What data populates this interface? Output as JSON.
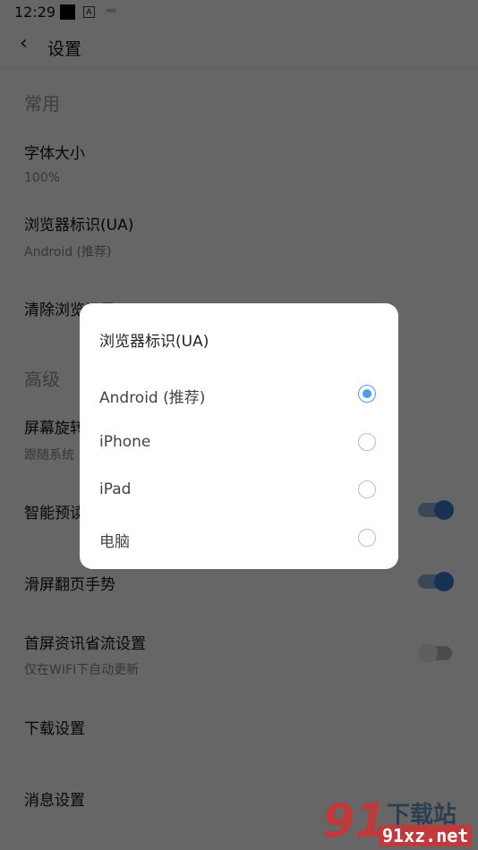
{
  "status_bar": {
    "time": "12:29",
    "icons": [
      "square-notification-icon",
      "a-notification-icon",
      "hms-icon",
      "wifi-icon",
      "battery-charging-icon"
    ],
    "hms_label": "HMS",
    "a_label": "A"
  },
  "header": {
    "back_icon": "‹",
    "title": "设置"
  },
  "sections": [
    {
      "label": "常用"
    },
    {
      "label": "高级"
    }
  ],
  "settings": {
    "font_size": {
      "title": "字体大小",
      "value": "100%"
    },
    "user_agent": {
      "title": "浏览器标识(UA)",
      "value": "Android (推荐)"
    },
    "clear_history": {
      "title": "清除浏览记录"
    },
    "screen_rotation": {
      "title": "屏幕旋转",
      "value": "跟随系统"
    },
    "smart_preload": {
      "title": "智能预读",
      "enabled": true
    },
    "swipe_gesture": {
      "title": "滑屏翻页手势",
      "enabled": true
    },
    "data_saver": {
      "title": "首屏资讯省流设置",
      "subtitle": "仅在WIFI下自动更新",
      "enabled": false
    },
    "download": {
      "title": "下载设置"
    },
    "message": {
      "title": "消息设置"
    }
  },
  "dialog": {
    "title": "浏览器标识(UA)",
    "options": [
      {
        "label": "Android (推荐)",
        "selected": true
      },
      {
        "label": "iPhone",
        "selected": false
      },
      {
        "label": "iPad",
        "selected": false
      },
      {
        "label": "电脑",
        "selected": false
      }
    ],
    "accent_color": "#4a9cf5"
  },
  "watermark": {
    "number": "91",
    "text": "下载站",
    "domain": "91xz.net"
  }
}
